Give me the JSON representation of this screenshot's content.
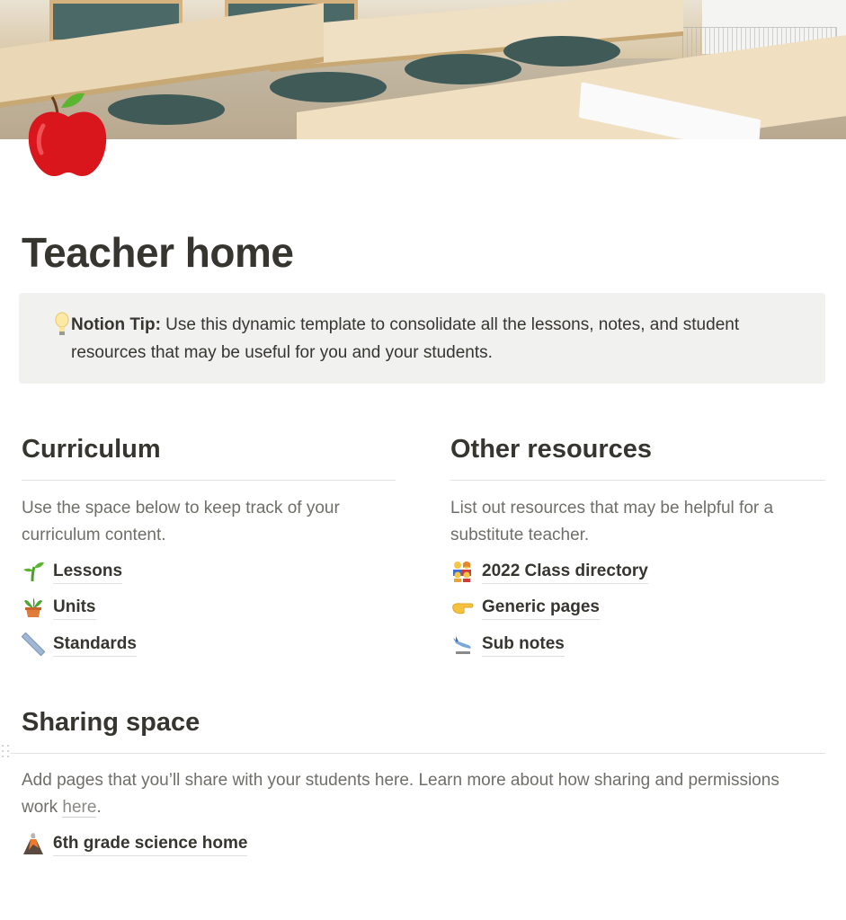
{
  "page": {
    "cover_description": "Classroom with tables and chairs",
    "icon": "red-apple-icon",
    "title": "Teacher home"
  },
  "callout": {
    "icon": "light-bulb-icon",
    "bold_label": "Notion Tip:",
    "text": " Use this dynamic template to consolidate all the lessons, notes, and student resources that may be useful for you and your students.",
    "background": "#f1f1ef"
  },
  "curriculum": {
    "heading": "Curriculum",
    "description": "Use the space below to keep track of your curriculum content.",
    "links": [
      {
        "icon": "seedling-icon",
        "label": "Lessons"
      },
      {
        "icon": "potted-plant-icon",
        "label": "Units"
      },
      {
        "icon": "ruler-icon",
        "label": "Standards"
      }
    ]
  },
  "other_resources": {
    "heading": "Other resources",
    "description": "List out resources that may be helpful for a substitute teacher.",
    "links": [
      {
        "icon": "family-icon",
        "label": "2022 Class directory"
      },
      {
        "icon": "pointing-hand-icon",
        "label": "Generic pages"
      },
      {
        "icon": "airplane-departure-icon",
        "label": "Sub notes"
      }
    ]
  },
  "sharing_space": {
    "heading": "Sharing space",
    "description_before": "Add pages that you’ll share with your students here. Learn more about how sharing and permissions work ",
    "description_link": "here",
    "description_after": ".",
    "links": [
      {
        "icon": "volcano-icon",
        "label": "6th grade science home"
      }
    ]
  },
  "colors": {
    "text": "#37352f",
    "muted_text": "#6f6e69",
    "divider": "#e3e2e0"
  }
}
